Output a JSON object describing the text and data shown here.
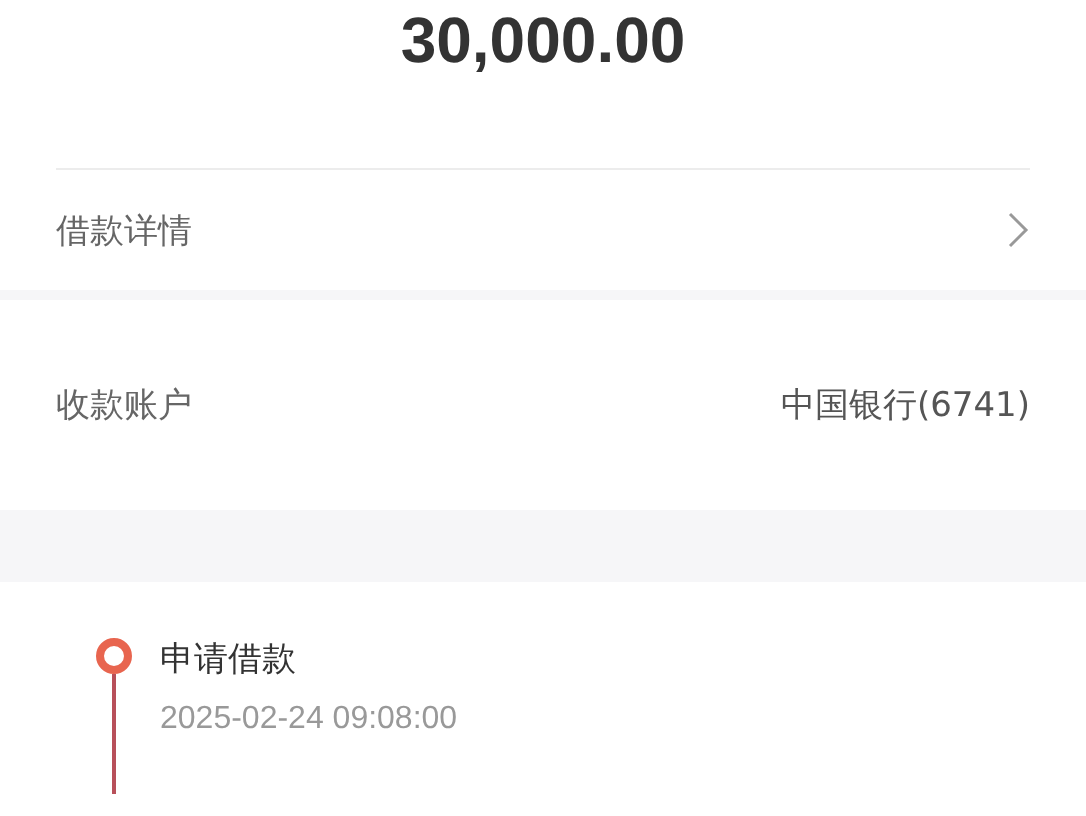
{
  "amount": "30,000.00",
  "detail_row": {
    "label": "借款详情"
  },
  "account_row": {
    "label": "收款账户",
    "value": "中国银行(6741)"
  },
  "timeline": [
    {
      "title": "申请借款",
      "time": "2025-02-24 09:08:00",
      "done": true
    }
  ]
}
